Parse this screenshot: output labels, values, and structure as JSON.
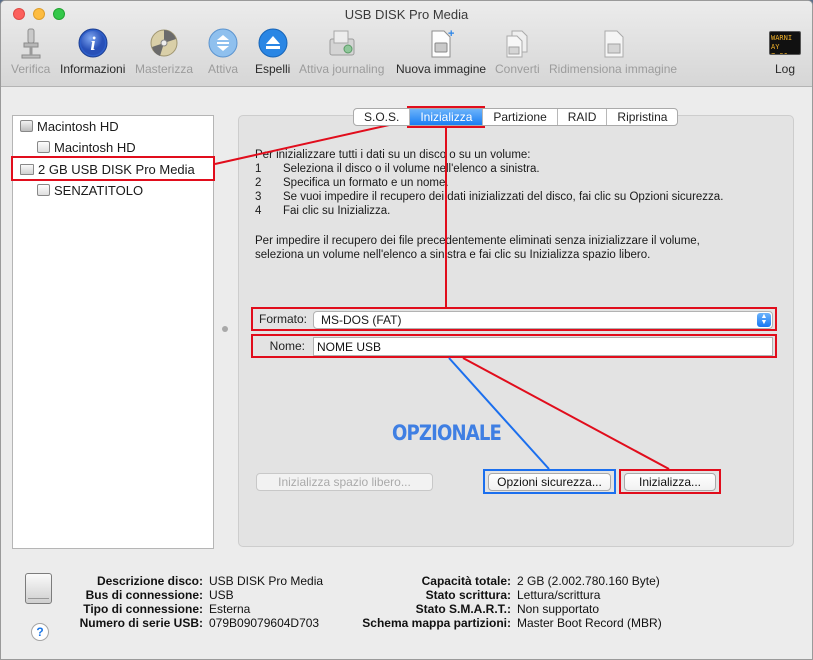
{
  "window": {
    "title": "USB DISK Pro Media"
  },
  "toolbar": {
    "items": [
      {
        "label": "Verifica",
        "icon": "microscope-icon",
        "enabled": false
      },
      {
        "label": "Informazioni",
        "icon": "info-icon",
        "enabled": true
      },
      {
        "label": "Masterizza",
        "icon": "burn-disc-icon",
        "enabled": false
      },
      {
        "label": "Attiva",
        "icon": "mount-icon",
        "enabled": false
      },
      {
        "label": "Espelli",
        "icon": "eject-icon",
        "enabled": true
      },
      {
        "label": "Attiva journaling",
        "icon": "journaling-icon",
        "enabled": false
      },
      {
        "label": "Nuova immagine",
        "icon": "new-image-icon",
        "enabled": true
      },
      {
        "label": "Converti",
        "icon": "convert-icon",
        "enabled": false
      },
      {
        "label": "Ridimensiona immagine",
        "icon": "resize-image-icon",
        "enabled": false
      },
      {
        "label": "Log",
        "icon": "log-icon",
        "enabled": true
      }
    ],
    "log_icon_text": [
      "WARNI",
      "AY 7:36"
    ]
  },
  "sidebar": {
    "items": [
      {
        "label": "Macintosh HD",
        "kind": "disk"
      },
      {
        "label": "Macintosh HD",
        "kind": "volume"
      },
      {
        "label": "2 GB USB DISK Pro Media",
        "kind": "usb-disk",
        "selected": true
      },
      {
        "label": "SENZATITOLO",
        "kind": "volume"
      }
    ]
  },
  "tabs": [
    {
      "label": "S.O.S."
    },
    {
      "label": "Inizializza",
      "active": true
    },
    {
      "label": "Partizione"
    },
    {
      "label": "RAID"
    },
    {
      "label": "Ripristina"
    }
  ],
  "erase": {
    "intro": "Per inizializzare tutti i dati su un disco o su un volume:",
    "steps": [
      {
        "n": "1",
        "text": "Seleziona il disco o il volume nell'elenco a sinistra."
      },
      {
        "n": "2",
        "text": "Specifica un formato e un nome."
      },
      {
        "n": "3",
        "text": "Se vuoi impedire il recupero dei dati inizializzati del disco, fai clic su Opzioni sicurezza."
      },
      {
        "n": "4",
        "text": "Fai clic su Inizializza."
      }
    ],
    "note_line1": "Per impedire il recupero dei file precedentemente eliminati senza inizializzare il volume,",
    "note_line2": "seleziona un volume nell'elenco a sinistra e fai clic su Inizializza spazio libero.",
    "format_label": "Formato:",
    "format_value": "MS-DOS (FAT)",
    "name_label": "Nome:",
    "name_value": "NOME USB",
    "free_space_button": "Inizializza spazio libero...",
    "security_button": "Opzioni sicurezza...",
    "erase_button": "Inizializza...",
    "annotation_optional": "OPZIONALE"
  },
  "info": {
    "left": [
      {
        "key": "Descrizione disco:",
        "value": "USB DISK Pro Media"
      },
      {
        "key": "Bus di connessione:",
        "value": "USB"
      },
      {
        "key": "Tipo di connessione:",
        "value": "Esterna"
      },
      {
        "key": "Numero di serie USB:",
        "value": "079B09079604D703"
      }
    ],
    "right": [
      {
        "key": "Capacità totale:",
        "value": "2 GB (2.002.780.160 Byte)"
      },
      {
        "key": "Stato scrittura:",
        "value": "Lettura/scrittura"
      },
      {
        "key": "Stato S.M.A.R.T.:",
        "value": "Non supportato"
      },
      {
        "key": "Schema mappa partizioni:",
        "value": "Master Boot Record (MBR)"
      }
    ],
    "help_label": "?"
  },
  "colors": {
    "accent": "#1a7ef3",
    "annotation_red": "#e10d1c",
    "annotation_blue": "#1b6fee"
  }
}
